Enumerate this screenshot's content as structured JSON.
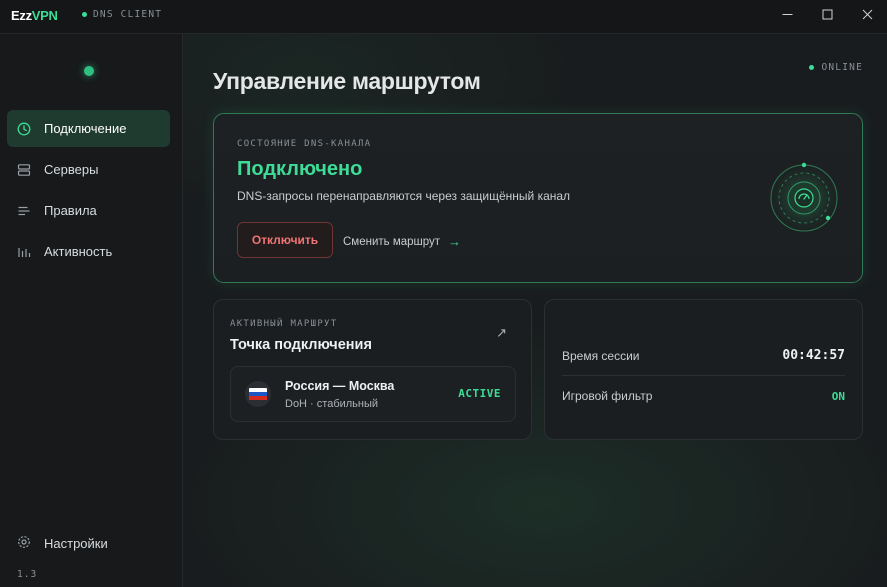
{
  "app": {
    "brand_part1": "Ezz",
    "brand_part2": "VPN",
    "tag": "DNS CLIENT",
    "accent": "#3ddc97"
  },
  "window_controls": {
    "minimize_icon": "minimize-icon",
    "maximize_icon": "maximize-icon",
    "close_icon": "close-icon"
  },
  "sidebar": {
    "items": [
      {
        "label": "Подключение",
        "icon": "clock-icon",
        "active": true
      },
      {
        "label": "Серверы",
        "icon": "server-icon",
        "active": false
      },
      {
        "label": "Правила",
        "icon": "list-icon",
        "active": false
      },
      {
        "label": "Активность",
        "icon": "bar-chart-icon",
        "active": false
      }
    ],
    "settings_label": "Настройки",
    "version": "1.3"
  },
  "main": {
    "online_label": "ONLINE",
    "title": "Управление маршрутом",
    "status_card": {
      "caption": "СОСТОЯНИЕ DNS-КАНАЛА",
      "status": "Подключено",
      "description": "DNS-запросы перенаправляются через защищённый канал",
      "disconnect_label": "Отключить",
      "change_route_label": "Сменить маршрут",
      "change_route_arrow": "→"
    },
    "route_card": {
      "caption": "АКТИВНЫЙ МАРШРУТ",
      "title": "Точка подключения",
      "external_icon": "↗",
      "location": "Россия — Москва",
      "location_sub": "DoH · стабильный",
      "badge": "ACTIVE"
    },
    "stats_card": {
      "session_label": "Время сессии",
      "session_value": "00:42:57",
      "filter_label": "Игровой фильтр",
      "filter_value": "ON"
    }
  }
}
